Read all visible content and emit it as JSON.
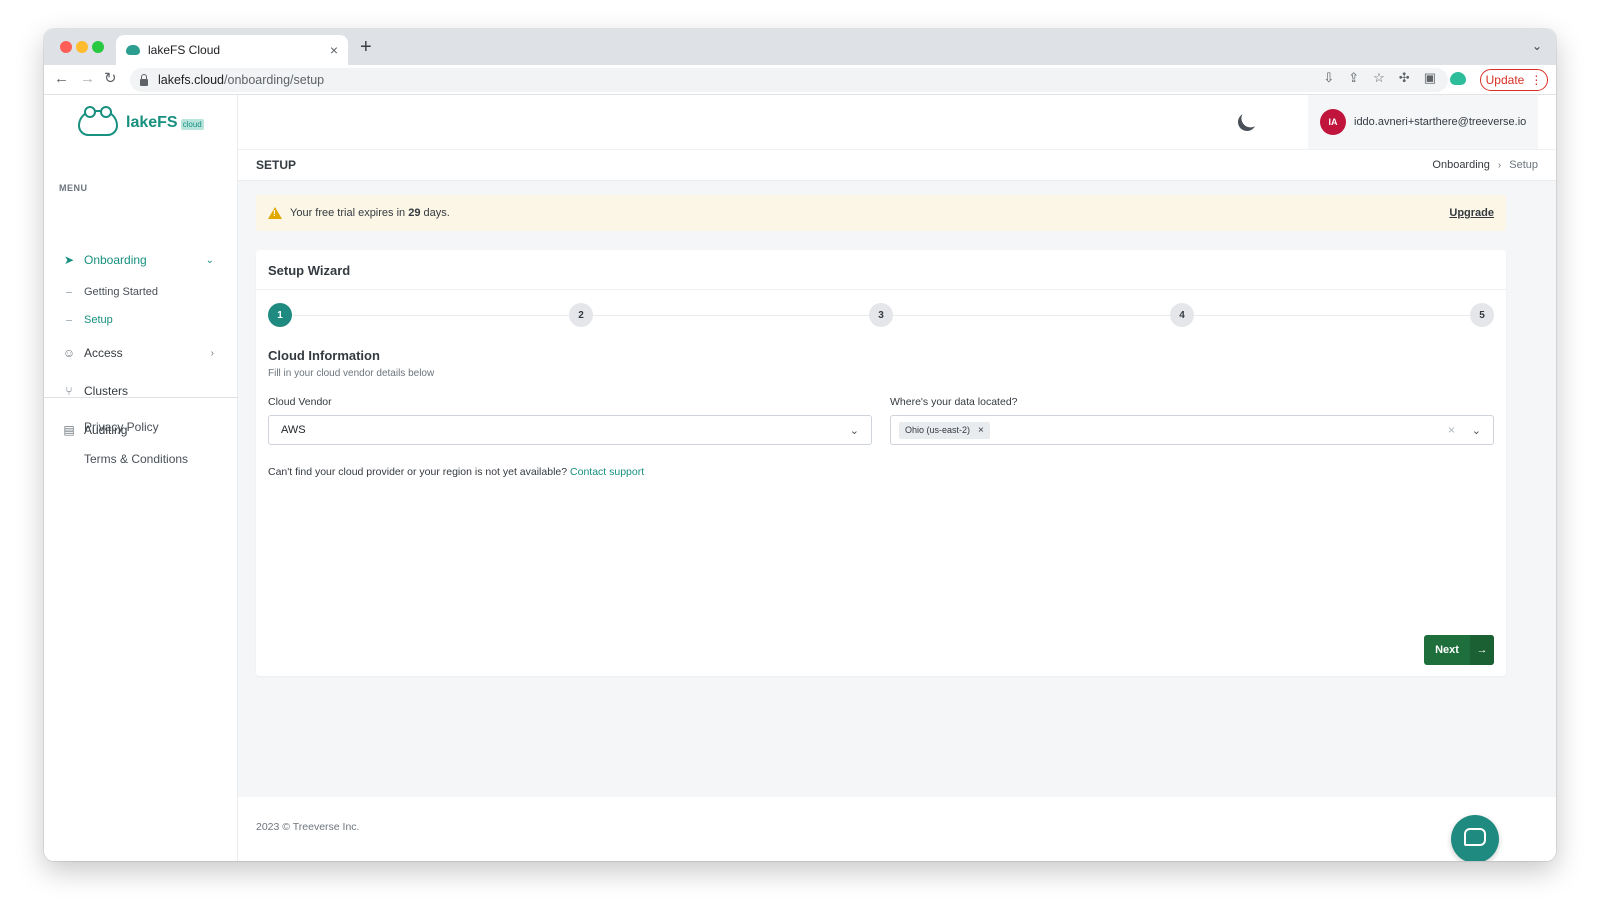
{
  "browser": {
    "tab_title": "lakeFS Cloud",
    "tab_close": "×",
    "new_tab": "+",
    "url_host": "lakefs.cloud",
    "url_path": "/onboarding/setup",
    "update_label": "Update"
  },
  "sidebar": {
    "logo_text": "lakeFS",
    "logo_badge": "cloud",
    "menu_label": "MENU",
    "items": [
      {
        "label": "Onboarding",
        "icon": "paper-plane-icon"
      },
      {
        "label": "Access",
        "icon": "user-icon"
      },
      {
        "label": "Clusters",
        "icon": "branch-icon"
      },
      {
        "label": "Auditing",
        "icon": "ledger-icon"
      }
    ],
    "sub_items": [
      {
        "label": "Getting Started"
      },
      {
        "label": "Setup"
      }
    ],
    "legal": [
      {
        "label": "Privacy Policy"
      },
      {
        "label": "Terms & Conditions"
      }
    ]
  },
  "header": {
    "avatar_initials": "IA",
    "user_email": "iddo.avneri+starthere@treeverse.io"
  },
  "page": {
    "title": "SETUP",
    "breadcrumb": [
      "Onboarding",
      "Setup"
    ]
  },
  "alert": {
    "text_before": "Your free trial expires in ",
    "days": "29",
    "text_after": " days.",
    "upgrade_label": "Upgrade"
  },
  "wizard": {
    "title": "Setup Wizard",
    "steps": [
      "1",
      "2",
      "3",
      "4",
      "5"
    ],
    "active_step": 1,
    "section_title": "Cloud Information",
    "section_subtitle": "Fill in your cloud vendor details below",
    "vendor_label": "Cloud Vendor",
    "vendor_value": "AWS",
    "location_label": "Where's your data located?",
    "location_tags": [
      "Ohio (us-east-2)"
    ],
    "help_text": "Can't find your cloud provider or your region is not yet available? ",
    "help_link": "Contact support",
    "next_label": "Next"
  },
  "footer": {
    "text": "2023 © Treeverse Inc."
  },
  "colors": {
    "brand": "#17907f",
    "primary_button": "#1e6f3b",
    "alert_bg": "#fcf6e6",
    "avatar": "#c0143c"
  }
}
